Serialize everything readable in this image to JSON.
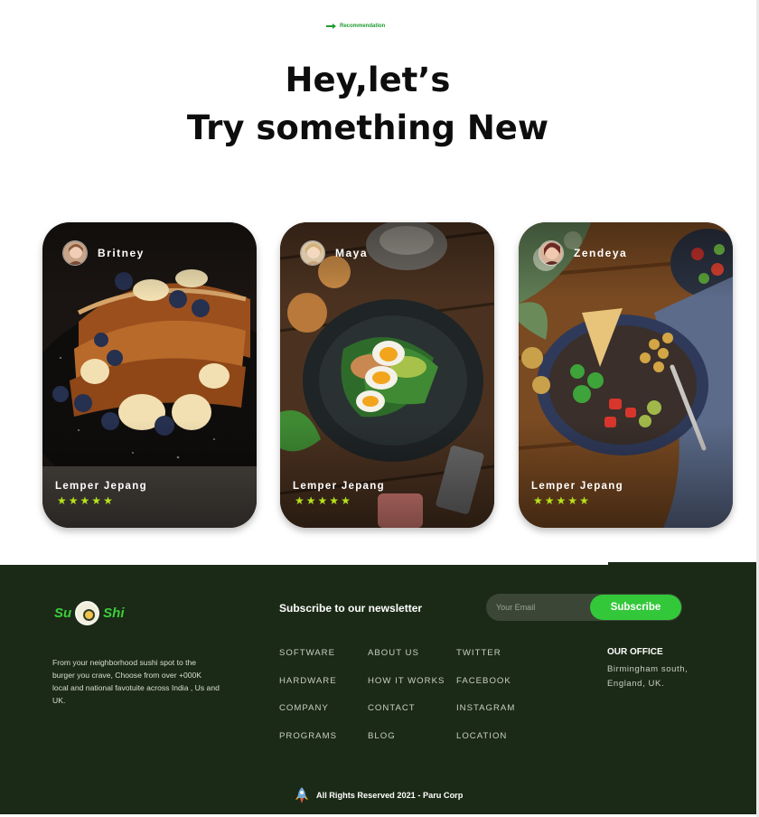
{
  "header": {
    "eyebrow": "Recommendation",
    "title_line1": "Hey,let’s",
    "title_line2": "Try something New"
  },
  "cards": [
    {
      "author": "Britney",
      "title": "Lemper Jepang",
      "rating": 5,
      "stars": "★★★★★",
      "photo_icon": "french-toast-photo"
    },
    {
      "author": "Maya",
      "title": "Lemper Jepang",
      "rating": 5,
      "stars": "★★★★★",
      "photo_icon": "egg-salad-photo"
    },
    {
      "author": "Zendeya",
      "title": "Lemper Jepang",
      "rating": 5,
      "stars": "★★★★★",
      "photo_icon": "veggie-bowl-photo"
    }
  ],
  "footer": {
    "logo_left": "Su",
    "logo_right": "Shi",
    "about": "From your neighborhood sushi spot to the burger you crave, Choose from over +000K local and national favotuite across  India , Us and UK.",
    "newsletter_title": "Subscribe to our newsletter",
    "email_placeholder": "Your Email",
    "subscribe_label": "Subscribe",
    "columns": [
      [
        "SOFTWARE",
        "HARDWARE",
        "COMPANY",
        "PROGRAMS"
      ],
      [
        "ABOUT US",
        "HOW IT WORKS",
        "CONTACT",
        "BLOG"
      ],
      [
        "TWITTER",
        "FACEBOOK",
        "INSTAGRAM",
        "LOCATION"
      ]
    ],
    "office_title": "OUR OFFICE",
    "office_address": "Birmingham south, England, UK.",
    "copyright": "All Rights Reserved 2021 - Paru Corp"
  },
  "colors": {
    "brand_green": "#33c83a",
    "footer_bg": "#1b2a16",
    "star": "#b6e21a"
  }
}
